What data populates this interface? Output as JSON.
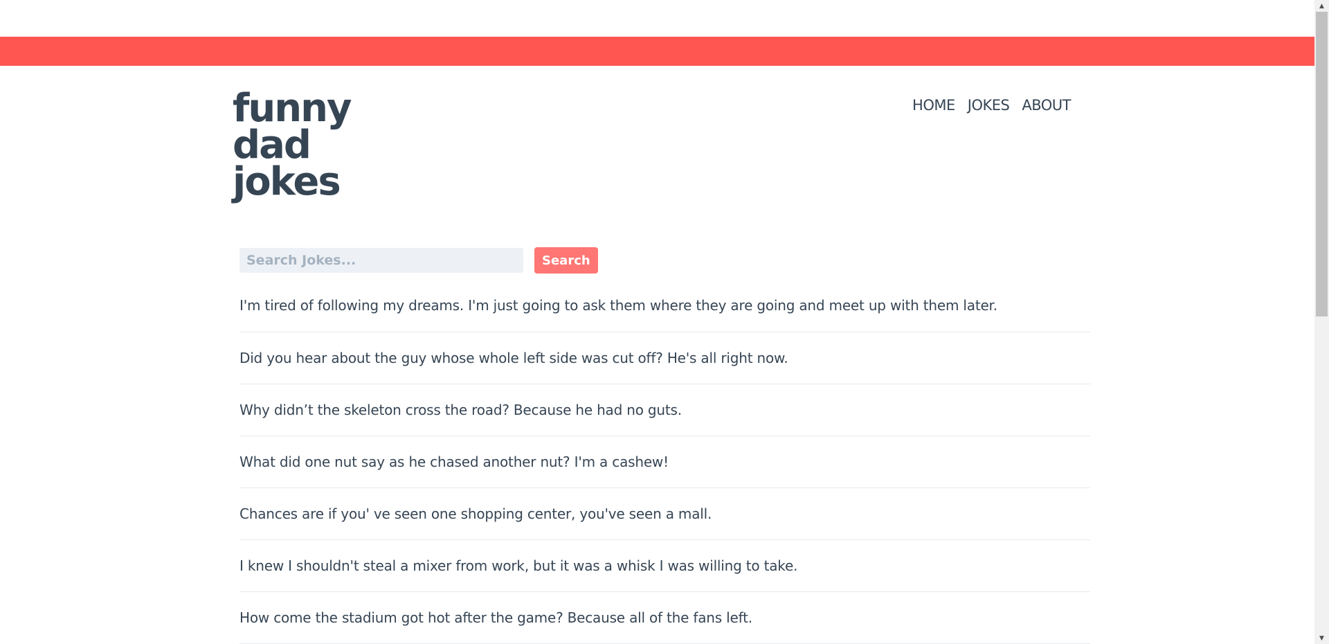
{
  "colors": {
    "accent": "#ff5652",
    "button": "#ff7674",
    "text": "#364554",
    "input_bg": "#edf1f5"
  },
  "logo": {
    "lines": [
      "funny",
      "dad",
      "jokes"
    ]
  },
  "nav": {
    "items": [
      "HOME",
      "JOKES",
      "ABOUT"
    ]
  },
  "search": {
    "placeholder": "Search Jokes...",
    "button_label": "Search"
  },
  "jokes": [
    "I'm tired of following my dreams. I'm just going to ask them where they are going and meet up with them later.",
    "Did you hear about the guy whose whole left side was cut off? He's all right now.",
    "Why didn’t the skeleton cross the road? Because he had no guts.",
    "What did one nut say as he chased another nut? I'm a cashew!",
    "Chances are if you' ve seen one shopping center, you've seen a mall.",
    "I knew I shouldn't steal a mixer from work, but it was a whisk I was willing to take.",
    "How come the stadium got hot after the game? Because all of the fans left."
  ],
  "scrollbar": {
    "up_icon": "chevron-up-icon",
    "down_icon": "chevron-down-icon"
  }
}
